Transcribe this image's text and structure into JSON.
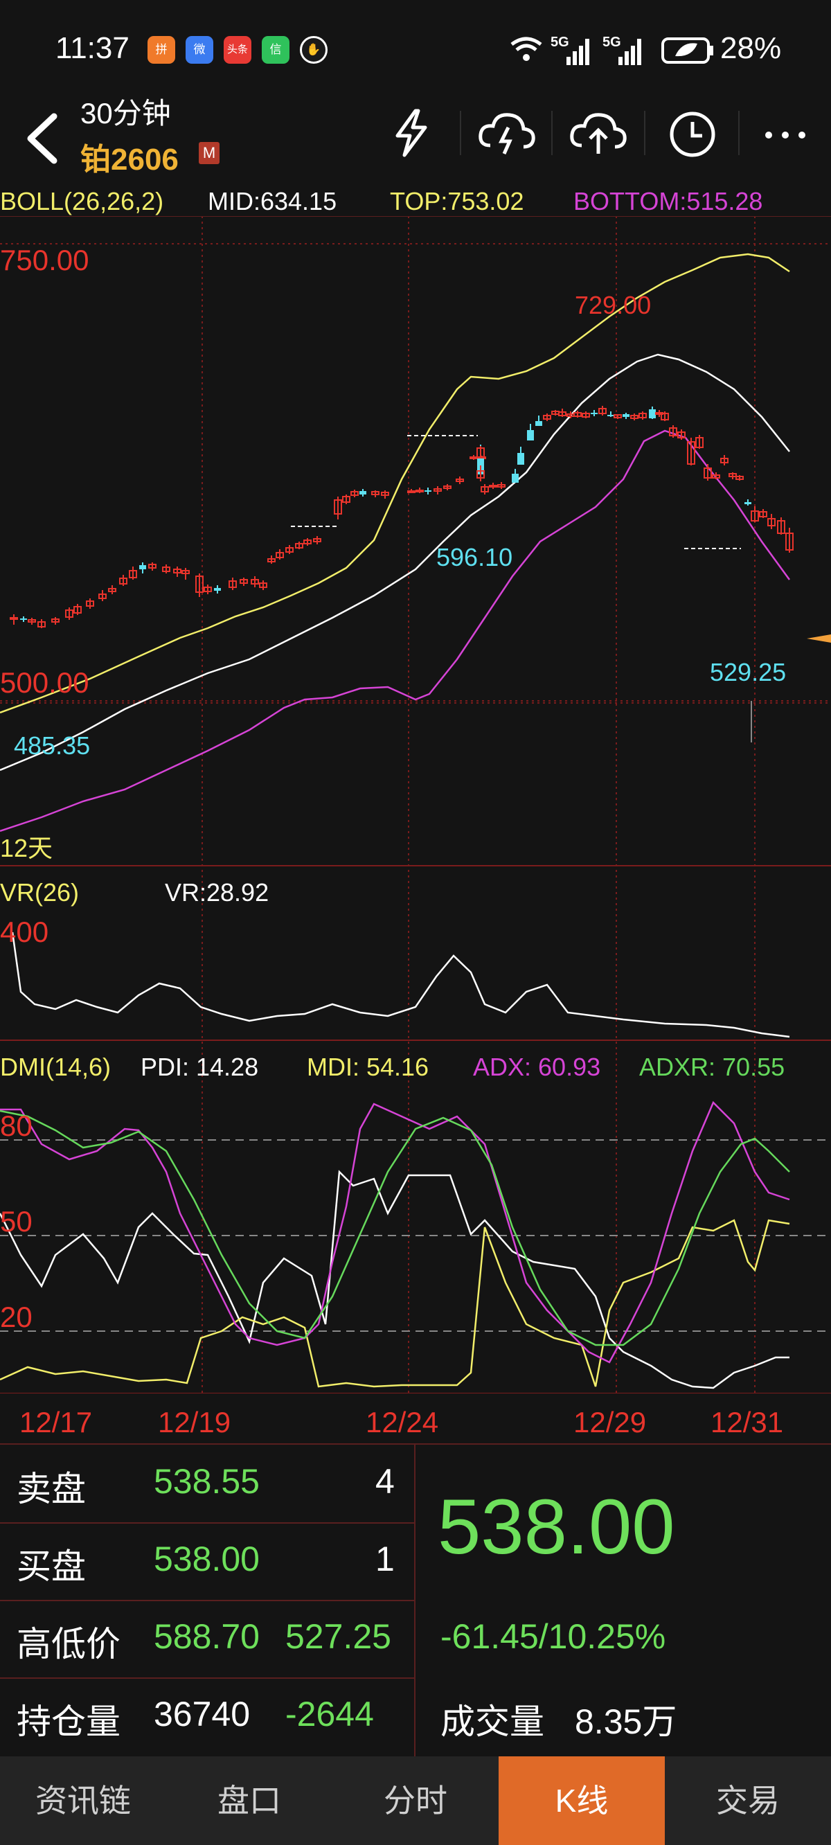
{
  "status_bar": {
    "time": "11:37",
    "apps": [
      "拼",
      "微",
      "头条",
      "信",
      "✋"
    ],
    "signal_1": "5G",
    "signal_2": "5G",
    "battery": "28%"
  },
  "header": {
    "title": "30分钟",
    "symbol": "铂2606",
    "badge": "M",
    "icons": [
      "lightning-icon",
      "cloud-download-icon",
      "cloud-upload-icon",
      "clock-icon",
      "more-icon"
    ]
  },
  "boll": {
    "name": "BOLL(26,26,2)",
    "mid": "MID:634.15",
    "top": "TOP:753.02",
    "bottom": "BOTTOM:515.28",
    "axis_high": "750.00",
    "axis_low": "500.00",
    "annot_high": "729.00",
    "annot_mid": "596.10",
    "annot_low_left": "485.35",
    "annot_low_right": "529.25",
    "span_label": "12天"
  },
  "vr": {
    "name": "VR(26)",
    "value": "VR:28.92",
    "axis": "400"
  },
  "dmi": {
    "name": "DMI(14,6)",
    "pdi": "PDI: 14.28",
    "mdi": "MDI: 54.16",
    "adx": "ADX: 60.93",
    "adxr": "ADXR: 70.55",
    "axis_80": "80",
    "axis_50": "50",
    "axis_20": "20"
  },
  "dates": [
    "12/17",
    "12/19",
    "12/24",
    "12/29",
    "12/31"
  ],
  "quote": {
    "sell_label": "卖盘",
    "sell_price": "538.55",
    "sell_qty": "4",
    "buy_label": "买盘",
    "buy_price": "538.00",
    "buy_qty": "1",
    "hilo_label": "高低价",
    "high": "588.70",
    "low": "527.25",
    "oi_label": "持仓量",
    "oi": "36740",
    "oi_change": "-2644",
    "last_price": "538.00",
    "change": "-61.45/10.25%",
    "volume_label": "成交量",
    "volume": "8.35万"
  },
  "tabs": [
    "资讯链",
    "盘口",
    "分时",
    "K线",
    "交易"
  ],
  "active_tab": "K线",
  "colors": {
    "up": "#e8342c",
    "down": "#5fe0f0",
    "boll_top": "#f2ee6a",
    "boll_mid": "#ffffff",
    "boll_bottom": "#d644d6",
    "green": "#6ee05b",
    "accent": "#e06a28"
  }
}
